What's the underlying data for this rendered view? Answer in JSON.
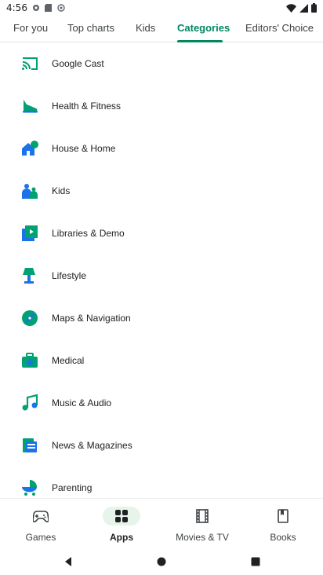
{
  "status_bar": {
    "time": "4:56",
    "notification_icons": [
      "circle-icon",
      "sd-card-icon",
      "wifi-icon"
    ],
    "system_icons": [
      "wifi-icon",
      "signal-icon",
      "battery-icon"
    ]
  },
  "tabs": [
    {
      "label": "For you",
      "active": false
    },
    {
      "label": "Top charts",
      "active": false
    },
    {
      "label": "Kids",
      "active": false
    },
    {
      "label": "Categories",
      "active": true
    },
    {
      "label": "Editors' Choice",
      "active": false
    }
  ],
  "categories": [
    {
      "label": "Google Cast",
      "icon": "cast-icon"
    },
    {
      "label": "Health & Fitness",
      "icon": "sneaker-icon"
    },
    {
      "label": "House & Home",
      "icon": "house-icon"
    },
    {
      "label": "Kids",
      "icon": "kids-icon"
    },
    {
      "label": "Libraries & Demo",
      "icon": "libraries-icon"
    },
    {
      "label": "Lifestyle",
      "icon": "lamp-icon"
    },
    {
      "label": "Maps & Navigation",
      "icon": "compass-icon"
    },
    {
      "label": "Medical",
      "icon": "medical-kit-icon"
    },
    {
      "label": "Music & Audio",
      "icon": "music-note-icon"
    },
    {
      "label": "News & Magazines",
      "icon": "news-icon"
    },
    {
      "label": "Parenting",
      "icon": "stroller-icon"
    }
  ],
  "bottom_nav": [
    {
      "label": "Games",
      "icon": "gamepad-icon",
      "active": false
    },
    {
      "label": "Apps",
      "icon": "apps-grid-icon",
      "active": true
    },
    {
      "label": "Movies & TV",
      "icon": "film-icon",
      "active": false
    },
    {
      "label": "Books",
      "icon": "book-icon",
      "active": false
    }
  ],
  "colors": {
    "accent": "#01875f",
    "icon_green": "#00a173",
    "icon_blue": "#1a73e8",
    "active_pill": "#e6f4ea"
  }
}
